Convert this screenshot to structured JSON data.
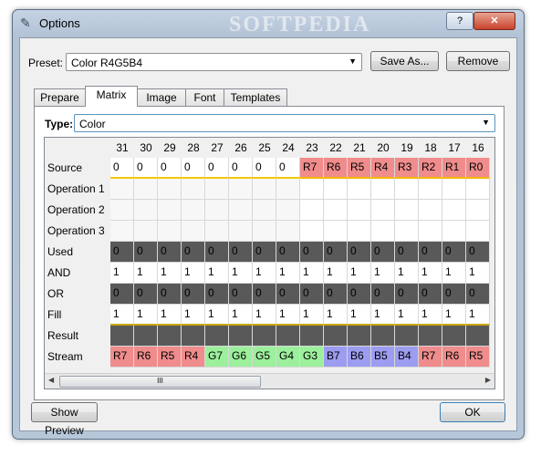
{
  "window": {
    "title": "Options",
    "watermark": "SOFTPEDIA"
  },
  "preset": {
    "label": "Preset:",
    "value": "Color R4G5B4",
    "save_as": "Save As...",
    "remove": "Remove"
  },
  "tabs": [
    "Prepare",
    "Matrix",
    "Image",
    "Font",
    "Templates"
  ],
  "type": {
    "label": "Type:",
    "value": "Color"
  },
  "bits": [
    "31",
    "30",
    "29",
    "28",
    "27",
    "26",
    "25",
    "24",
    "23",
    "22",
    "21",
    "20",
    "19",
    "18",
    "17",
    "16"
  ],
  "rows": [
    {
      "label": "Source",
      "values": [
        "0",
        "0",
        "0",
        "0",
        "0",
        "0",
        "0",
        "0",
        "R7",
        "R6",
        "R5",
        "R4",
        "R3",
        "R2",
        "R1",
        "R0"
      ]
    },
    {
      "label": "Operation 1",
      "values": [
        "",
        "",
        "",
        "",
        "",
        "",
        "",
        "",
        "",
        "",
        "",
        "",
        "",
        "",
        "",
        ""
      ]
    },
    {
      "label": "Operation 2",
      "values": [
        "",
        "",
        "",
        "",
        "",
        "",
        "",
        "",
        "",
        "",
        "",
        "",
        "",
        "",
        "",
        ""
      ]
    },
    {
      "label": "Operation 3",
      "values": [
        "",
        "",
        "",
        "",
        "",
        "",
        "",
        "",
        "",
        "",
        "",
        "",
        "",
        "",
        "",
        ""
      ]
    },
    {
      "label": "Used",
      "values": [
        "0",
        "0",
        "0",
        "0",
        "0",
        "0",
        "0",
        "0",
        "0",
        "0",
        "0",
        "0",
        "0",
        "0",
        "0",
        "0"
      ]
    },
    {
      "label": "AND",
      "values": [
        "1",
        "1",
        "1",
        "1",
        "1",
        "1",
        "1",
        "1",
        "1",
        "1",
        "1",
        "1",
        "1",
        "1",
        "1",
        "1"
      ]
    },
    {
      "label": "OR",
      "values": [
        "0",
        "0",
        "0",
        "0",
        "0",
        "0",
        "0",
        "0",
        "0",
        "0",
        "0",
        "0",
        "0",
        "0",
        "0",
        "0"
      ]
    },
    {
      "label": "Fill",
      "values": [
        "1",
        "1",
        "1",
        "1",
        "1",
        "1",
        "1",
        "1",
        "1",
        "1",
        "1",
        "1",
        "1",
        "1",
        "1",
        "1"
      ]
    },
    {
      "label": "Result",
      "values": [
        "",
        "",
        "",
        "",
        "",
        "",
        "",
        "",
        "",
        "",
        "",
        "",
        "",
        "",
        "",
        ""
      ]
    },
    {
      "label": "Stream",
      "values": [
        "R7",
        "R6",
        "R5",
        "R4",
        "G7",
        "G6",
        "G5",
        "G4",
        "G3",
        "B7",
        "B6",
        "B5",
        "B4",
        "R7",
        "R6",
        "R5"
      ]
    }
  ],
  "scroll_grip": "III",
  "footer": {
    "show_preview": "Show Preview",
    "ok": "OK"
  },
  "colors": {
    "red": "#f08c8c",
    "green": "#9cf09c",
    "blue": "#9c9cf0",
    "dark": "#595959",
    "yellow_bar": "#f5c800",
    "focus": "#3c7fb1"
  }
}
